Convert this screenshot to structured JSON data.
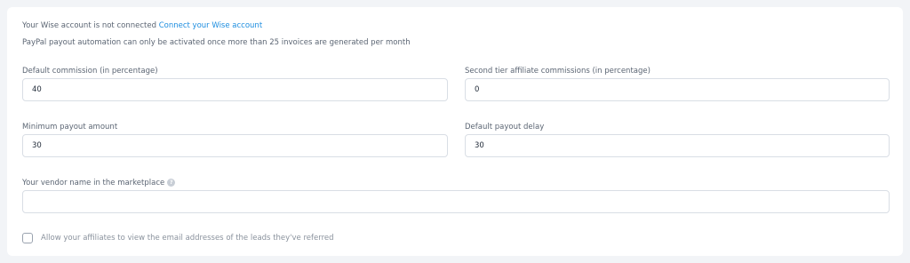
{
  "wise": {
    "status_text": "Your Wise account is not connected",
    "connect_link": "Connect your Wise account"
  },
  "paypal_note": "PayPal payout automation can only be activated once more than 25 invoices are generated per month",
  "fields": {
    "default_commission": {
      "label": "Default commission (in percentage)",
      "value": "40"
    },
    "second_tier": {
      "label": "Second tier affiliate commissions (in percentage)",
      "value": "0"
    },
    "minimum_payout": {
      "label": "Minimum payout amount",
      "value": "30"
    },
    "payout_delay": {
      "label": "Default payout delay",
      "value": "30"
    },
    "vendor_name": {
      "label": "Your vendor name in the marketplace",
      "value": "",
      "help_icon": "question-mark-icon"
    }
  },
  "allow_emails": {
    "label": "Allow your affiliates to view the email addresses of the leads they've referred",
    "checked": false
  },
  "colors": {
    "link": "#1d8ddf",
    "background": "#f2f4f7",
    "panel": "#ffffff",
    "border": "#d9dee5"
  }
}
